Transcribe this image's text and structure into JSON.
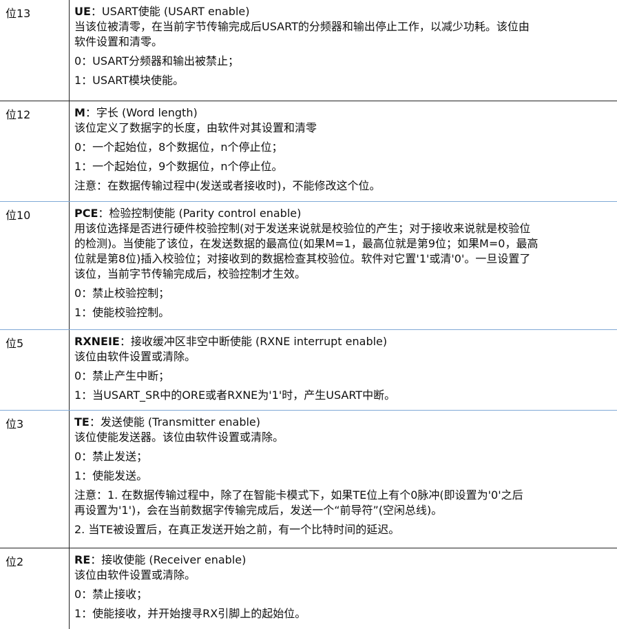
{
  "rows": [
    {
      "bit": "位13",
      "name": "UE",
      "title_rest": "：USART使能 (USART enable)",
      "lines": [
        "当该位被清零，在当前字节传输完成后USART的分频器和输出停止工作，以减少功耗。该位由",
        "软件设置和清零。",
        "",
        "0：USART分频器和输出被禁止；",
        "",
        "1：USART模块使能。"
      ]
    },
    {
      "bit": "位12",
      "name": "M",
      "title_rest": "：字长 (Word length)",
      "lines": [
        "该位定义了数据字的长度，由软件对其设置和清零",
        "",
        "0：一个起始位，8个数据位，n个停止位；",
        "",
        "1：一个起始位，9个数据位，n个停止位。",
        "",
        "注意：在数据传输过程中(发送或者接收时)，不能修改这个位。"
      ]
    },
    {
      "bit": "位10",
      "name": "PCE",
      "title_rest": "：检验控制使能 (Parity control enable)",
      "lines": [
        "用该位选择是否进行硬件校验控制(对于发送来说就是校验位的产生；对于接收来说就是校验位",
        "的检测)。当使能了该位，在发送数据的最高位(如果M=1，最高位就是第9位；如果M=0，最高",
        "位就是第8位)插入校验位；对接收到的数据检查其校验位。软件对它置'1'或清'0'。一旦设置了",
        "该位，当前字节传输完成后，校验控制才生效。",
        "",
        "0：禁止校验控制；",
        "",
        "1：使能校验控制。"
      ]
    },
    {
      "bit": "位5",
      "name": "RXNEIE",
      "title_rest": "：接收缓冲区非空中断使能 (RXNE interrupt enable)",
      "lines": [
        "该位由软件设置或清除。",
        "",
        "0：禁止产生中断；",
        "",
        "1：当USART_SR中的ORE或者RXNE为'1'时，产生USART中断。"
      ]
    },
    {
      "bit": "位3",
      "name": "TE",
      "title_rest": "：发送使能 (Transmitter enable)",
      "lines": [
        "该位使能发送器。该位由软件设置或清除。",
        "",
        "0：禁止发送；",
        "",
        "1：使能发送。",
        "",
        "注意：1. 在数据传输过程中，除了在智能卡模式下，如果TE位上有个0脉冲(即设置为'0'之后",
        "再设置为'1')，会在当前数据字传输完成后，发送一个“前导符”(空闲总线)。",
        "",
        "2. 当TE被设置后，在真正发送开始之前，有一个比特时间的延迟。"
      ]
    },
    {
      "bit": "位2",
      "name": "RE",
      "title_rest": "：接收使能 (Receiver enable)",
      "lines": [
        "该位由软件设置或清除。",
        "",
        "0：禁止接收；",
        "",
        "1：使能接收，并开始搜寻RX引脚上的起始位。"
      ]
    }
  ]
}
